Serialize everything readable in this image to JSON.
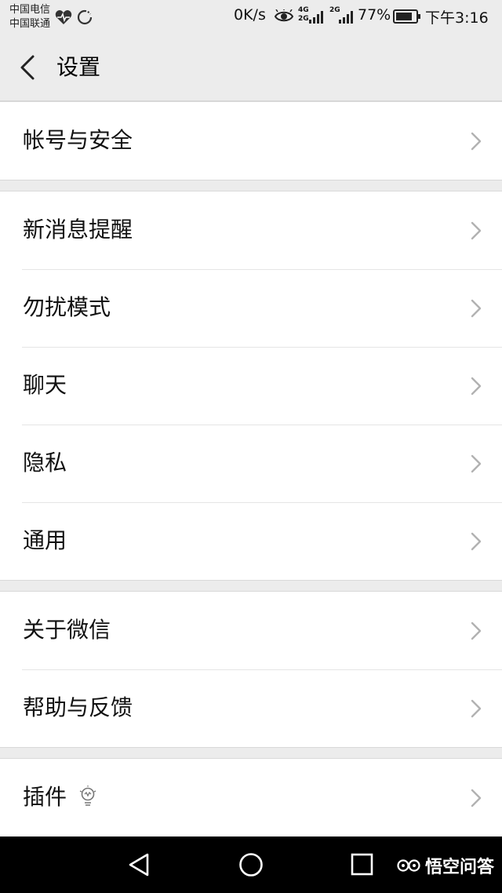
{
  "status_bar": {
    "carrier_1": "中国电信",
    "carrier_2": "中国联通",
    "speed": "0K/s",
    "net_4g": "4G",
    "net_2g_a": "2G",
    "net_2g_b": "2G",
    "battery": "77%",
    "time": "下午3:16",
    "icons": [
      "heartbeat-icon",
      "sync-icon",
      "eye-icon",
      "signal-icon",
      "battery-icon"
    ]
  },
  "header": {
    "title": "设置",
    "back_icon": "back-arrow-icon"
  },
  "groups": [
    {
      "items": [
        {
          "label": "帐号与安全"
        }
      ]
    },
    {
      "items": [
        {
          "label": "新消息提醒"
        },
        {
          "label": "勿扰模式"
        },
        {
          "label": "聊天"
        },
        {
          "label": "隐私"
        },
        {
          "label": "通用"
        }
      ]
    },
    {
      "items": [
        {
          "label": "关于微信"
        },
        {
          "label": "帮助与反馈"
        }
      ]
    },
    {
      "items": [
        {
          "label": "插件",
          "icon": "lightbulb-icon"
        }
      ]
    }
  ],
  "nav_bar": {
    "back": "triangle-back-icon",
    "home": "circle-home-icon",
    "recents": "square-recents-icon"
  },
  "watermark": {
    "text": "悟空问答"
  },
  "colors": {
    "background": "#ececec",
    "card": "#ffffff",
    "chevron": "#b2b2b2",
    "navbar": "#000000"
  }
}
